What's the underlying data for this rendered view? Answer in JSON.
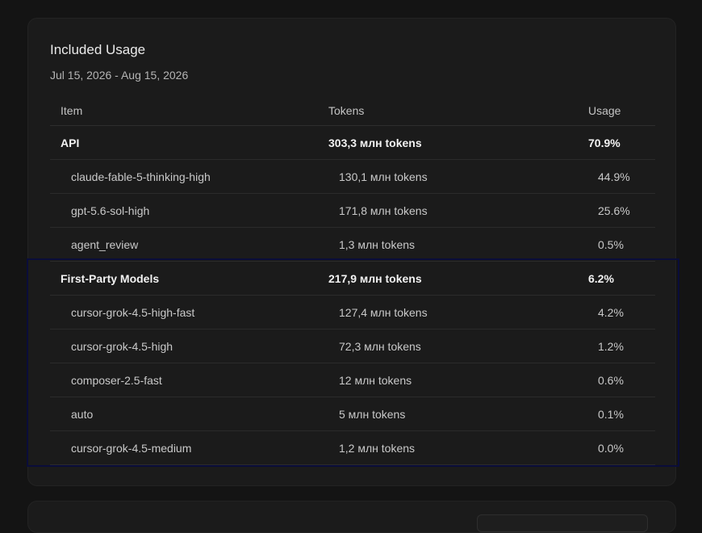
{
  "card": {
    "title": "Included Usage",
    "date_range": "Jul 15, 2026 - Aug 15, 2026"
  },
  "table": {
    "headers": {
      "item": "Item",
      "tokens": "Tokens",
      "usage": "Usage"
    },
    "groups": [
      {
        "name": "API",
        "tokens": "303,3 млн tokens",
        "usage": "70.9%",
        "items": [
          {
            "name": "claude-fable-5-thinking-high",
            "tokens": "130,1 млн tokens",
            "usage": "44.9%"
          },
          {
            "name": "gpt-5.6-sol-high",
            "tokens": "171,8 млн tokens",
            "usage": "25.6%"
          },
          {
            "name": "agent_review",
            "tokens": "1,3 млн tokens",
            "usage": "0.5%"
          }
        ]
      },
      {
        "name": "First-Party Models",
        "tokens": "217,9 млн tokens",
        "usage": "6.2%",
        "items": [
          {
            "name": "cursor-grok-4.5-high-fast",
            "tokens": "127,4 млн tokens",
            "usage": "4.2%"
          },
          {
            "name": "cursor-grok-4.5-high",
            "tokens": "72,3 млн tokens",
            "usage": "1.2%"
          },
          {
            "name": "composer-2.5-fast",
            "tokens": "12 млн tokens",
            "usage": "0.6%"
          },
          {
            "name": "auto",
            "tokens": "5 млн tokens",
            "usage": "0.1%"
          },
          {
            "name": "cursor-grok-4.5-medium",
            "tokens": "1,2 млн tokens",
            "usage": "0.0%"
          }
        ]
      }
    ]
  },
  "colors": {
    "background": "#141414",
    "card": "#1b1b1b",
    "highlight_border": "#0a0d3a"
  }
}
